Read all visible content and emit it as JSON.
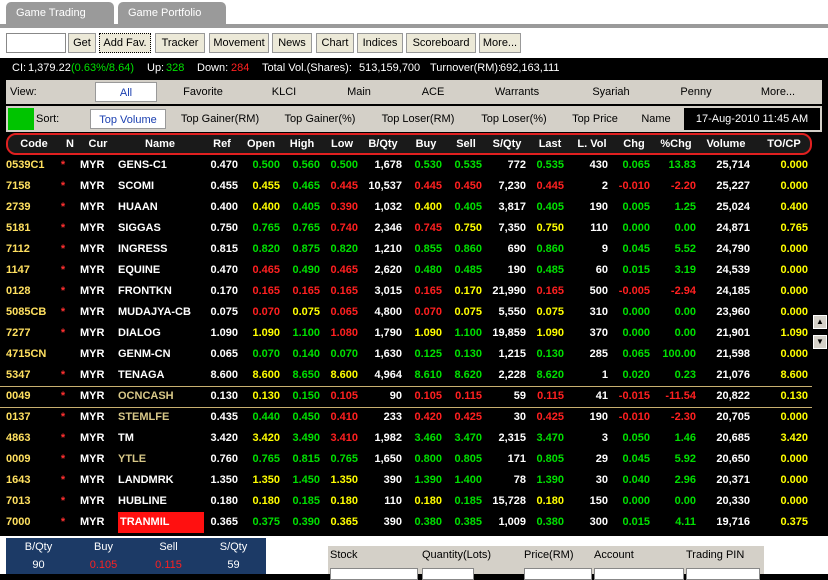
{
  "tabs": [
    "Game Trading",
    "Game Portfolio"
  ],
  "toolbar": {
    "search_value": "",
    "buttons": [
      "Get",
      "Add Fav.",
      "Tracker",
      "Movement",
      "News",
      "Chart",
      "Indices",
      "Scoreboard",
      "More..."
    ]
  },
  "stats": {
    "ci_label": "CI:",
    "ci_value": "1,379.22",
    "ci_change": "(0.63%/8.64)",
    "up_label": "Up:",
    "up_value": "328",
    "down_label": "Down:",
    "down_value": "284",
    "vol_label": "Total Vol.(Shares):",
    "vol_value": "513,159,700",
    "turnover_label": "Turnover(RM):",
    "turnover_value": "692,163,111"
  },
  "view": {
    "label": "View:",
    "options": [
      "All",
      "Favorite",
      "KLCI",
      "Main",
      "ACE",
      "Warrants",
      "Syariah",
      "Penny",
      "More..."
    ],
    "active": "All"
  },
  "sort": {
    "label": "Sort:",
    "options": [
      "Top Volume",
      "Top Gainer(RM)",
      "Top Gainer(%)",
      "Top Loser(RM)",
      "Top Loser(%)",
      "Top Price",
      "Name"
    ],
    "active": "Top Volume",
    "datetime": "17-Aug-2010 11:45 AM"
  },
  "columns": [
    "Code",
    "N",
    "Cur",
    "Name",
    "Ref",
    "Open",
    "High",
    "Low",
    "B/Qty",
    "Buy",
    "Sell",
    "S/Qty",
    "Last",
    "L. Vol",
    "Chg",
    "%Chg",
    "Volume",
    "TO/CP"
  ],
  "rows": [
    {
      "code": "0539C1",
      "n": "*",
      "cur": "MYR",
      "name": "GENS-C1",
      "ref": "0.470",
      "open": "0.500",
      "high": "0.560",
      "low": "0.500",
      "bqty": "1,678",
      "buy": "0.530",
      "sell": "0.535",
      "sqty": "772",
      "last": "0.535",
      "lvol": "430",
      "chg": "0.065",
      "pchg": "13.83",
      "volume": "25,714",
      "tocp": "0.000"
    },
    {
      "code": "7158",
      "n": "*",
      "cur": "MYR",
      "name": "SCOMI",
      "ref": "0.455",
      "open": "0.455",
      "high": "0.465",
      "low": "0.445",
      "bqty": "10,537",
      "buy": "0.445",
      "sell": "0.450",
      "sqty": "7,230",
      "last": "0.445",
      "lvol": "2",
      "chg": "-0.010",
      "pchg": "-2.20",
      "volume": "25,227",
      "tocp": "0.000"
    },
    {
      "code": "2739",
      "n": "*",
      "cur": "MYR",
      "name": "HUAAN",
      "ref": "0.400",
      "open": "0.400",
      "high": "0.405",
      "low": "0.390",
      "bqty": "1,032",
      "buy": "0.400",
      "sell": "0.405",
      "sqty": "3,817",
      "last": "0.405",
      "lvol": "190",
      "chg": "0.005",
      "pchg": "1.25",
      "volume": "25,024",
      "tocp": "0.400"
    },
    {
      "code": "5181",
      "n": "*",
      "cur": "MYR",
      "name": "SIGGAS",
      "ref": "0.750",
      "open": "0.765",
      "high": "0.765",
      "low": "0.740",
      "bqty": "2,346",
      "buy": "0.745",
      "sell": "0.750",
      "sqty": "7,350",
      "last": "0.750",
      "lvol": "110",
      "chg": "0.000",
      "pchg": "0.00",
      "volume": "24,871",
      "tocp": "0.765"
    },
    {
      "code": "7112",
      "n": "*",
      "cur": "MYR",
      "name": "INGRESS",
      "ref": "0.815",
      "open": "0.820",
      "high": "0.875",
      "low": "0.820",
      "bqty": "1,210",
      "buy": "0.855",
      "sell": "0.860",
      "sqty": "690",
      "last": "0.860",
      "lvol": "9",
      "chg": "0.045",
      "pchg": "5.52",
      "volume": "24,790",
      "tocp": "0.000"
    },
    {
      "code": "1147",
      "n": "*",
      "cur": "MYR",
      "name": "EQUINE",
      "ref": "0.470",
      "open": "0.465",
      "high": "0.490",
      "low": "0.465",
      "bqty": "2,620",
      "buy": "0.480",
      "sell": "0.485",
      "sqty": "190",
      "last": "0.485",
      "lvol": "60",
      "chg": "0.015",
      "pchg": "3.19",
      "volume": "24,539",
      "tocp": "0.000"
    },
    {
      "code": "0128",
      "n": "*",
      "cur": "MYR",
      "name": "FRONTKN",
      "ref": "0.170",
      "open": "0.165",
      "high": "0.165",
      "low": "0.165",
      "bqty": "3,015",
      "buy": "0.165",
      "sell": "0.170",
      "sqty": "21,990",
      "last": "0.165",
      "lvol": "500",
      "chg": "-0.005",
      "pchg": "-2.94",
      "volume": "24,185",
      "tocp": "0.000"
    },
    {
      "code": "5085CB",
      "n": "*",
      "cur": "MYR",
      "name": "MUDAJYA-CB",
      "ref": "0.075",
      "open": "0.070",
      "high": "0.075",
      "low": "0.065",
      "bqty": "4,800",
      "buy": "0.070",
      "sell": "0.075",
      "sqty": "5,550",
      "last": "0.075",
      "lvol": "310",
      "chg": "0.000",
      "pchg": "0.00",
      "volume": "23,960",
      "tocp": "0.000"
    },
    {
      "code": "7277",
      "n": "*",
      "cur": "MYR",
      "name": "DIALOG",
      "ref": "1.090",
      "open": "1.090",
      "high": "1.100",
      "low": "1.080",
      "bqty": "1,790",
      "buy": "1.090",
      "sell": "1.100",
      "sqty": "19,859",
      "last": "1.090",
      "lvol": "370",
      "chg": "0.000",
      "pchg": "0.00",
      "volume": "21,901",
      "tocp": "1.090"
    },
    {
      "code": "4715CN",
      "n": "",
      "cur": "MYR",
      "name": "GENM-CN",
      "ref": "0.065",
      "open": "0.070",
      "high": "0.140",
      "low": "0.070",
      "bqty": "1,630",
      "buy": "0.125",
      "sell": "0.130",
      "sqty": "1,215",
      "last": "0.130",
      "lvol": "285",
      "chg": "0.065",
      "pchg": "100.00",
      "volume": "21,598",
      "tocp": "0.000"
    },
    {
      "code": "5347",
      "n": "*",
      "cur": "MYR",
      "name": "TENAGA",
      "ref": "8.600",
      "open": "8.600",
      "high": "8.650",
      "low": "8.600",
      "bqty": "4,964",
      "buy": "8.610",
      "sell": "8.620",
      "sqty": "2,228",
      "last": "8.620",
      "lvol": "1",
      "chg": "0.020",
      "pchg": "0.23",
      "volume": "21,076",
      "tocp": "8.600"
    },
    {
      "code": "0049",
      "n": "*",
      "cur": "MYR",
      "name": "OCNCASH",
      "ref": "0.130",
      "open": "0.130",
      "high": "0.150",
      "low": "0.105",
      "bqty": "90",
      "buy": "0.105",
      "sell": "0.115",
      "sqty": "59",
      "last": "0.115",
      "lvol": "41",
      "chg": "-0.015",
      "pchg": "-11.54",
      "volume": "20,822",
      "tocp": "0.130"
    },
    {
      "code": "0137",
      "n": "*",
      "cur": "MYR",
      "name": "STEMLFE",
      "ref": "0.435",
      "open": "0.440",
      "high": "0.450",
      "low": "0.410",
      "bqty": "233",
      "buy": "0.420",
      "sell": "0.425",
      "sqty": "30",
      "last": "0.425",
      "lvol": "190",
      "chg": "-0.010",
      "pchg": "-2.30",
      "volume": "20,705",
      "tocp": "0.000"
    },
    {
      "code": "4863",
      "n": "*",
      "cur": "MYR",
      "name": "TM",
      "ref": "3.420",
      "open": "3.420",
      "high": "3.490",
      "low": "3.410",
      "bqty": "1,982",
      "buy": "3.460",
      "sell": "3.470",
      "sqty": "2,315",
      "last": "3.470",
      "lvol": "3",
      "chg": "0.050",
      "pchg": "1.46",
      "volume": "20,685",
      "tocp": "3.420"
    },
    {
      "code": "0009",
      "n": "*",
      "cur": "MYR",
      "name": "YTLE",
      "ref": "0.760",
      "open": "0.765",
      "high": "0.815",
      "low": "0.765",
      "bqty": "1,650",
      "buy": "0.800",
      "sell": "0.805",
      "sqty": "171",
      "last": "0.805",
      "lvol": "29",
      "chg": "0.045",
      "pchg": "5.92",
      "volume": "20,650",
      "tocp": "0.000"
    },
    {
      "code": "1643",
      "n": "*",
      "cur": "MYR",
      "name": "LANDMRK",
      "ref": "1.350",
      "open": "1.350",
      "high": "1.450",
      "low": "1.350",
      "bqty": "390",
      "buy": "1.390",
      "sell": "1.400",
      "sqty": "78",
      "last": "1.390",
      "lvol": "30",
      "chg": "0.040",
      "pchg": "2.96",
      "volume": "20,371",
      "tocp": "0.000"
    },
    {
      "code": "7013",
      "n": "*",
      "cur": "MYR",
      "name": "HUBLINE",
      "ref": "0.180",
      "open": "0.180",
      "high": "0.185",
      "low": "0.180",
      "bqty": "110",
      "buy": "0.180",
      "sell": "0.185",
      "sqty": "15,728",
      "last": "0.180",
      "lvol": "150",
      "chg": "0.000",
      "pchg": "0.00",
      "volume": "20,330",
      "tocp": "0.000"
    },
    {
      "code": "7000",
      "n": "*",
      "cur": "MYR",
      "name": "TRANMIL",
      "ref": "0.365",
      "open": "0.375",
      "high": "0.390",
      "low": "0.365",
      "bqty": "390",
      "buy": "0.380",
      "sell": "0.385",
      "sqty": "1,009",
      "last": "0.380",
      "lvol": "300",
      "chg": "0.015",
      "pchg": "4.11",
      "volume": "19,716",
      "tocp": "0.375"
    }
  ],
  "bottom_quote": {
    "headers": [
      "B/Qty",
      "Buy",
      "Sell",
      "S/Qty"
    ],
    "values": [
      "90",
      "0.105",
      "0.115",
      "59"
    ]
  },
  "order_panel": {
    "headers": [
      "Stock",
      "Quantity(Lots)",
      "Price(RM)",
      "Account",
      "Trading PIN"
    ]
  },
  "colors": {
    "up": "#00e000",
    "down": "#ff2020",
    "neutral": "#ffffff",
    "highlight": "#ffff00",
    "code": "#ffe060"
  }
}
